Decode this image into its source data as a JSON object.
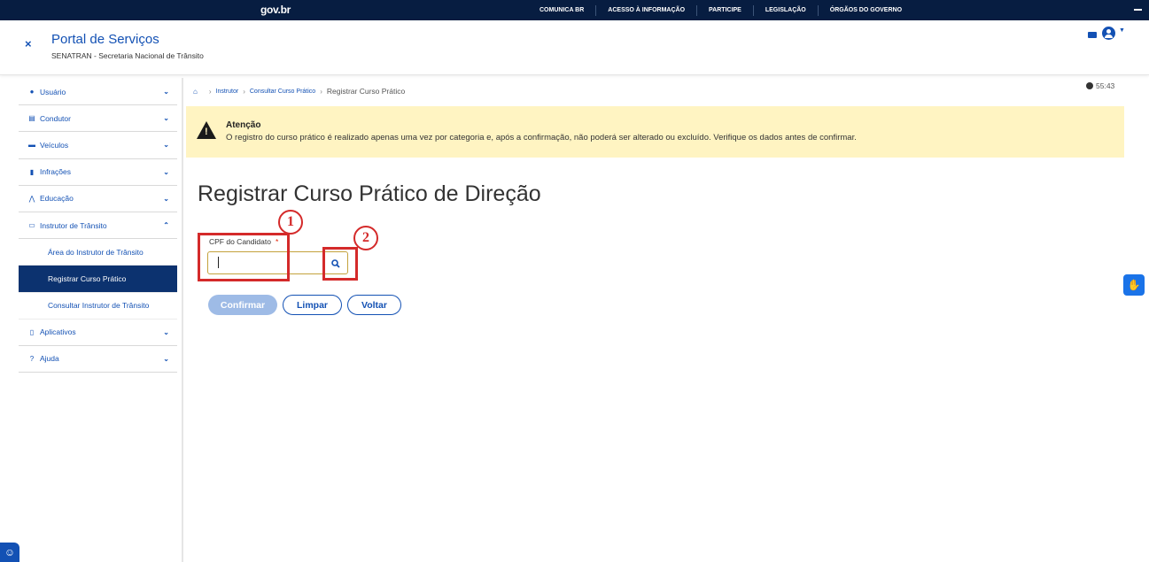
{
  "govbar": {
    "logo": "gov.br",
    "links": [
      "COMUNICA BR",
      "ACESSO À INFORMAÇÃO",
      "PARTICIPE",
      "LEGISLAÇÃO",
      "ÓRGÃOS DO GOVERNO"
    ]
  },
  "header": {
    "close": "×",
    "title": "Portal de Serviços",
    "subtitle": "SENATRAN - Secretaria Nacional de Trânsito"
  },
  "sidebar": {
    "items": [
      {
        "label": "Usuário",
        "icon": "user-icon"
      },
      {
        "label": "Condutor",
        "icon": "id-card-icon"
      },
      {
        "label": "Veículos",
        "icon": "car-icon"
      },
      {
        "label": "Infrações",
        "icon": "document-icon"
      },
      {
        "label": "Educação",
        "icon": "road-icon"
      },
      {
        "label": "Instrutor de Trânsito",
        "icon": "instructor-icon"
      }
    ],
    "subitems": [
      "Área do Instrutor de Trânsito",
      "Registrar Curso Prático",
      "Consultar Instrutor de Trânsito"
    ],
    "items_after": [
      {
        "label": "Aplicativos",
        "icon": "phone-icon"
      },
      {
        "label": "Ajuda",
        "icon": "help-icon"
      }
    ]
  },
  "breadcrumb": {
    "items": [
      "Instrutor",
      "Consultar Curso Prático"
    ],
    "current": "Registrar Curso Prático"
  },
  "timer": "55:43",
  "alert": {
    "title": "Atenção",
    "text": "O registro do curso prático é realizado apenas uma vez por categoria e, após a confirmação, não poderá ser alterado ou excluído. Verifique os dados antes de confirmar."
  },
  "page_title": "Registrar Curso Prático de Direção",
  "form": {
    "cpf_label": "CPF do Candidato",
    "required_mark": "*",
    "cpf_value": ""
  },
  "buttons": {
    "confirm": "Confirmar",
    "clear": "Limpar",
    "back": "Voltar"
  },
  "annotations": [
    "1",
    "2"
  ],
  "colors": {
    "brand_blue": "#1351b4",
    "govbar": "#071d41",
    "alert_bg": "#fff4c2",
    "annotation_red": "#d42a2a"
  }
}
